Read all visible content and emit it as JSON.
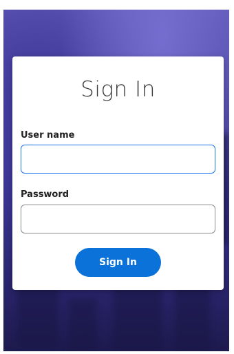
{
  "signin": {
    "title": "Sign In",
    "username_label": "User name",
    "username_value": "",
    "password_label": "Password",
    "password_value": "",
    "submit_label": "Sign In"
  },
  "colors": {
    "accent": "#0a72d8",
    "background": "#3a3490"
  }
}
